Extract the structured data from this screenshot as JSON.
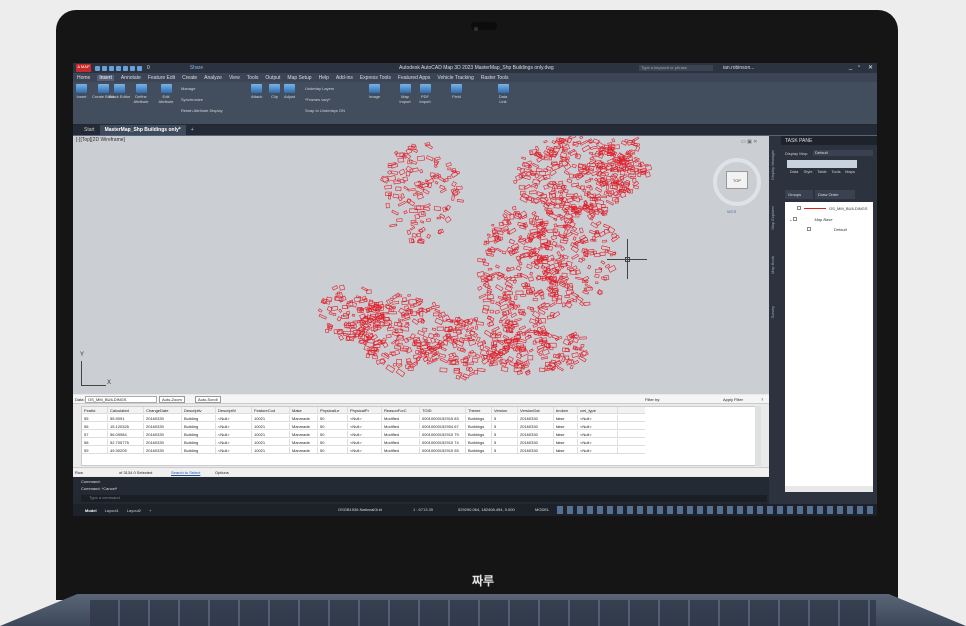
{
  "device": {
    "brand": "짜루"
  },
  "app": {
    "badge": "A MAP",
    "layer_name": "0",
    "share": "Share",
    "title": "Autodesk AutoCAD Map 3D 2023   MasterMap_Shp Buildings only.dwg",
    "search_placeholder": "Type a keyword or phrase",
    "user": "ian.robinson..."
  },
  "menu": [
    "Home",
    "Insert",
    "Annotate",
    "Feature Edit",
    "Create",
    "Analyze",
    "View",
    "Tools",
    "Output",
    "Map Setup",
    "Help",
    "Add-ins",
    "Express Tools",
    "Featured Apps",
    "Vehicle Tracking",
    "Raster Tools"
  ],
  "menu_active": "Insert",
  "ribbon": {
    "block_buttons": [
      "Insert",
      "Create Block",
      "Block Editor",
      "Define Attribute",
      "Edit Attribute"
    ],
    "attr_small": [
      "Manage",
      "Synchronize",
      "Retain Attribute Display"
    ],
    "ref_buttons": [
      "Attach",
      "Clip",
      "Adjust"
    ],
    "ref_small": [
      "Underlay Layers",
      "*Frames vary*",
      "Snap to Underlays ON"
    ],
    "image_buttons": [
      "Image"
    ],
    "import_buttons": [
      "Map Import",
      "PDF Import"
    ],
    "data_buttons": [
      "Field"
    ],
    "link_buttons": [
      "Data Link"
    ],
    "panels": [
      "Block",
      "AutoCAD Attributes",
      "Reference",
      "Image",
      "Import",
      "AutoCAD Data",
      "Linking and Extraction"
    ]
  },
  "tabs": [
    "Start",
    "MasterMap_Shp Buildings only*"
  ],
  "viewport": {
    "label": "[-][Top][2D Wireframe]",
    "viewcube": "TOP",
    "wcs": "WCS",
    "ucs_y": "Y",
    "ucs_x": "X",
    "building_color": "#e0202c"
  },
  "taskpane": {
    "title": "TASK PANE",
    "display_map_label": "Display Map:",
    "display_map_value": "Default",
    "tools": [
      "Data",
      "Style",
      "Table",
      "Tools",
      "Maps"
    ],
    "tab_groups": "Groups",
    "tab_draw_order": "Draw Order",
    "items": [
      "OS_MM_BUILDINGS",
      "Map Base",
      "Default"
    ],
    "side_tabs": [
      "Display Manager",
      "Map Explorer",
      "Map Book",
      "Survey"
    ]
  },
  "datatable": {
    "data_label": "Data:",
    "source": "OS_MM_BUILDINGS",
    "auto_zoom": "Auto-Zoom",
    "auto_scroll": "Auto-Scroll",
    "filter_label": "Filter by:",
    "apply_filter": "Apply Filter",
    "help": "?",
    "columns": [
      "FeatId",
      "Calculated",
      "ChangeDate",
      "Descriptiv",
      "DescriptiV",
      "FeatureCod",
      "Make",
      "PhysicalLe",
      "PhysicalPr",
      "ReasonForC",
      "TOID",
      "Theme",
      "Version",
      "VersionDat",
      "broken",
      "cml_type"
    ],
    "rows": [
      [
        "55",
        "55.9091",
        "20160330",
        "Building",
        "<Null>",
        "10021",
        "Manmade",
        "50",
        "<Null>",
        "Modified",
        "00010000152915 83",
        "Buildings",
        "5",
        "20160330",
        "false",
        "<Null>"
      ],
      [
        "56",
        "15.120325",
        "20160330",
        "Building",
        "<Null>",
        "10021",
        "Manmade",
        "50",
        "<Null>",
        "Modified",
        "00010000152904 67",
        "Buildings",
        "5",
        "20160330",
        "false",
        "<Null>"
      ],
      [
        "57",
        "56.09984",
        "20160330",
        "Building",
        "<Null>",
        "10021",
        "Manmade",
        "50",
        "<Null>",
        "Modified",
        "00010000152910 79",
        "Buildings",
        "5",
        "20160330",
        "false",
        "<Null>"
      ],
      [
        "58",
        "52.705775",
        "20160330",
        "Building",
        "<Null>",
        "10021",
        "Manmade",
        "50",
        "<Null>",
        "Modified",
        "00010000152910 74",
        "Buildings",
        "5",
        "20160330",
        "false",
        "<Null>"
      ],
      [
        "59",
        "49.30205",
        "20160330",
        "Building",
        "<Null>",
        "10021",
        "Manmade",
        "50",
        "<Null>",
        "Modified",
        "00010000152919 55",
        "Buildings",
        "5",
        "20160330",
        "false",
        "<Null>"
      ]
    ],
    "status_row": "Row",
    "status_count": "of 3134   0 Selected",
    "search_to_select": "Search to Select",
    "options": "Options"
  },
  "command": {
    "lines": [
      "Command:",
      "Command: *Cancel*"
    ],
    "placeholder": "Type a command"
  },
  "statusbar": {
    "tabs": [
      "Model",
      "Layout1",
      "Layout2"
    ],
    "grid": "OSGB1936.NationalGrid",
    "scale": "1 : 6713.39",
    "coords": "529290.064, 182408.494, 0.000",
    "mode": "MODEL"
  }
}
